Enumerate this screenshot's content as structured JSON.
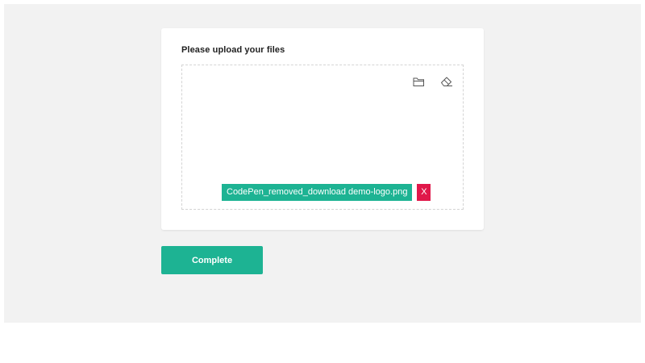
{
  "upload_card": {
    "title": "Please upload your files",
    "toolbar": {
      "browse_icon": "folder-open-icon",
      "clear_icon": "eraser-icon"
    },
    "files": [
      {
        "name": "CodePen_removed_download demo-logo.png",
        "remove_label": "X"
      }
    ]
  },
  "actions": {
    "complete_label": "Complete"
  },
  "colors": {
    "accent": "#1db393",
    "danger": "#e0184a",
    "background": "#f2f2f2",
    "card": "#ffffff"
  }
}
